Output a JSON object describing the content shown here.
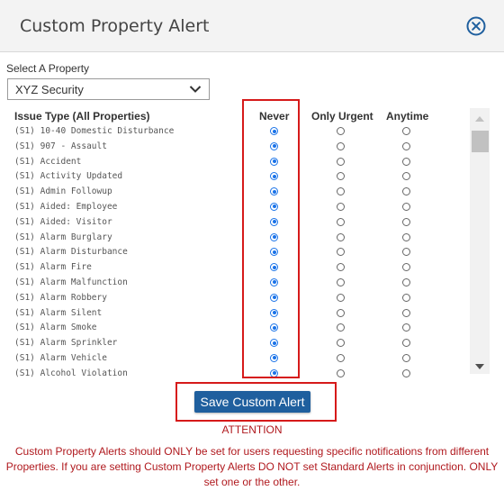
{
  "dialog": {
    "title": "Custom Property Alert",
    "close_icon": "close-circle-icon"
  },
  "property": {
    "label": "Select A Property",
    "selected": "XYZ Security"
  },
  "table": {
    "headers": {
      "issue": "Issue Type (All Properties)",
      "never": "Never",
      "urgent": "Only Urgent",
      "anytime": "Anytime"
    },
    "rows": [
      {
        "issue": "(S1) 10-40 Domestic Disturbance",
        "selected": "never"
      },
      {
        "issue": "(S1) 907 - Assault",
        "selected": "never"
      },
      {
        "issue": "(S1) Accident",
        "selected": "never"
      },
      {
        "issue": "(S1) Activity Updated",
        "selected": "never"
      },
      {
        "issue": "(S1) Admin Followup",
        "selected": "never"
      },
      {
        "issue": "(S1) Aided: Employee",
        "selected": "never"
      },
      {
        "issue": "(S1) Aided: Visitor",
        "selected": "never"
      },
      {
        "issue": "(S1) Alarm Burglary",
        "selected": "never"
      },
      {
        "issue": "(S1) Alarm Disturbance",
        "selected": "never"
      },
      {
        "issue": "(S1) Alarm Fire",
        "selected": "never"
      },
      {
        "issue": "(S1) Alarm Malfunction",
        "selected": "never"
      },
      {
        "issue": "(S1) Alarm Robbery",
        "selected": "never"
      },
      {
        "issue": "(S1) Alarm Silent",
        "selected": "never"
      },
      {
        "issue": "(S1) Alarm Smoke",
        "selected": "never"
      },
      {
        "issue": "(S1) Alarm Sprinkler",
        "selected": "never"
      },
      {
        "issue": "(S1) Alarm Vehicle",
        "selected": "never"
      },
      {
        "issue": "(S1) Alcohol Violation",
        "selected": "never"
      }
    ]
  },
  "actions": {
    "save_label": "Save Custom Alert"
  },
  "notice": {
    "heading": "ATTENTION",
    "body": "Custom Property Alerts should ONLY be set for users requesting specific notifications from different Properties. If you are setting Custom Property Alerts DO NOT set Standard Alerts in conjunction. ONLY set one or the other."
  },
  "colors": {
    "accent": "#1f5f9e",
    "radio_checked": "#1a73e8",
    "highlight": "#d61a1a",
    "warning_text": "#b0191e"
  }
}
